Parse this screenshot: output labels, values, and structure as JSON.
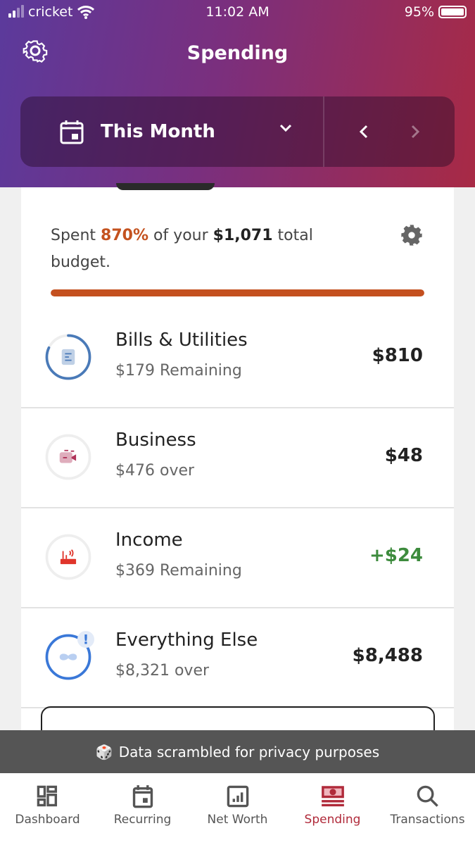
{
  "status_bar": {
    "carrier": "cricket",
    "time": "11:02 AM",
    "battery": "95%"
  },
  "header": {
    "title": "Spending"
  },
  "period": {
    "label": "This Month"
  },
  "summary": {
    "prefix": "Spent ",
    "percent": "870%",
    "middle": " of your ",
    "budget": "$1,071",
    "suffix": " total budget.",
    "progress": 1.0
  },
  "categories": [
    {
      "name": "Bills & Utilities",
      "sub": "$179 Remaining",
      "amount": "$810",
      "icon": "receipt-icon",
      "color": "#4a7ab8",
      "progress": 0.82
    },
    {
      "name": "Business",
      "sub": "$476 over",
      "amount": "$48",
      "icon": "video-camera-icon",
      "color": "#b0345a",
      "progress": 0
    },
    {
      "name": "Income",
      "sub": "$369 Remaining",
      "amount": "+$24",
      "icon": "router-icon",
      "color": "#e0352b",
      "progress": 0
    },
    {
      "name": "Everything Else",
      "sub": "$8,321 over",
      "amount": "$8,488",
      "icon": "infinity-icon",
      "color": "#3a78d8",
      "progress": 1.0,
      "alert": "!"
    }
  ],
  "banner": {
    "text": "Data scrambled for privacy purposes"
  },
  "nav": [
    {
      "label": "Dashboard"
    },
    {
      "label": "Recurring"
    },
    {
      "label": "Net Worth"
    },
    {
      "label": "Spending",
      "active": true
    },
    {
      "label": "Transactions"
    }
  ],
  "colors": {
    "accent": "#b02a3a",
    "over_budget": "#c4501f",
    "positive": "#3d8b3d"
  }
}
